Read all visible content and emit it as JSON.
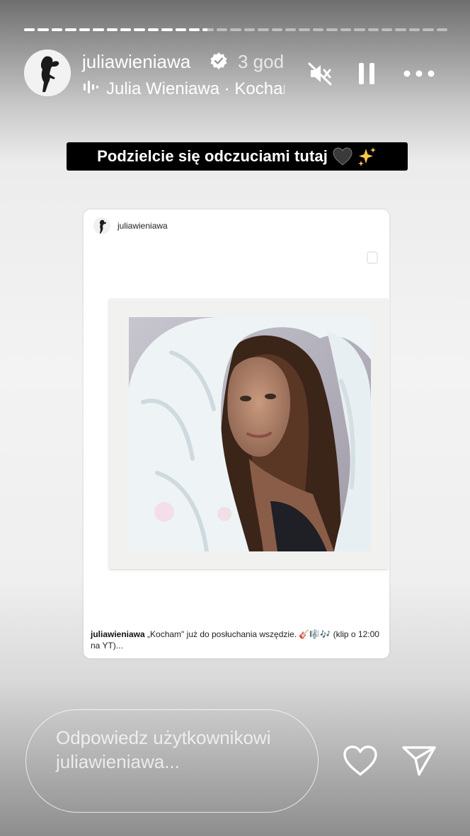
{
  "story": {
    "progress_segments": [
      1,
      1,
      1,
      1,
      1,
      1,
      1,
      1,
      1,
      1,
      1,
      1,
      1,
      0.4,
      0,
      0,
      0,
      0,
      0,
      0,
      0,
      0,
      0,
      0,
      0,
      0,
      0,
      0,
      0,
      0,
      0
    ]
  },
  "header": {
    "username": "juliawieniawa",
    "time": "3 god",
    "music": "Julia Wieniawa · Kocham"
  },
  "sticker": {
    "text": "Podzielcie się odczuciami tutaj"
  },
  "post": {
    "username": "juliawieniawa",
    "caption_user": "juliawieniawa",
    "caption_text": " „Kocham\" już do posłuchania wszędzie. 🎸🎼🎶 (klip o 12:00 na YT)..."
  },
  "footer": {
    "reply_placeholder": "Odpowiedz użytkownikowi juliawieniawa..."
  },
  "colors": {
    "sticker_bg": "#000000",
    "text_light": "#ffffff"
  },
  "icons": [
    "verified-badge-icon",
    "music-bars-icon",
    "mute-icon",
    "pause-icon",
    "more-icon",
    "bookmark-icon",
    "heart-icon",
    "send-icon"
  ]
}
